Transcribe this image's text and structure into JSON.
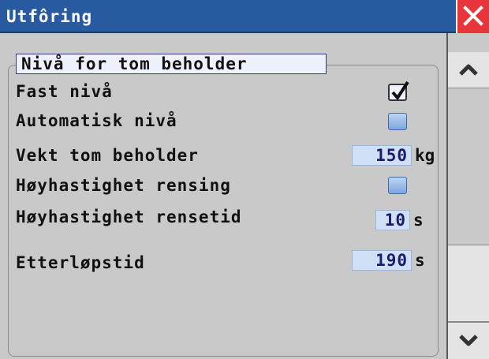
{
  "window": {
    "title": "Utfôring",
    "close_icon": "close-x-icon",
    "colors": {
      "titlebar": "#285aa0",
      "close": "#e8343b",
      "background": "#c9c9c9",
      "field": "#cfe0f5"
    }
  },
  "group": {
    "header": "Nivå for tom beholder"
  },
  "rows": {
    "fast_niva": {
      "label": "Fast nivå",
      "checked": true
    },
    "automatisk_niva": {
      "label": "Automatisk nivå",
      "checked": false
    },
    "vekt": {
      "label": "Vekt tom beholder",
      "value": "150",
      "unit": "kg"
    },
    "hoyhastighet_rensing": {
      "label": "Høyhastighet rensing",
      "checked": false
    },
    "rensetid": {
      "label": "Høyhastighet rensetid",
      "value": "10",
      "unit": "s"
    },
    "etterlopstid": {
      "label": "Etterløpstid",
      "value": "190",
      "unit": "s"
    }
  },
  "scrollbar": {
    "up_icon": "chevron-up-icon",
    "down_icon": "chevron-down-icon"
  }
}
